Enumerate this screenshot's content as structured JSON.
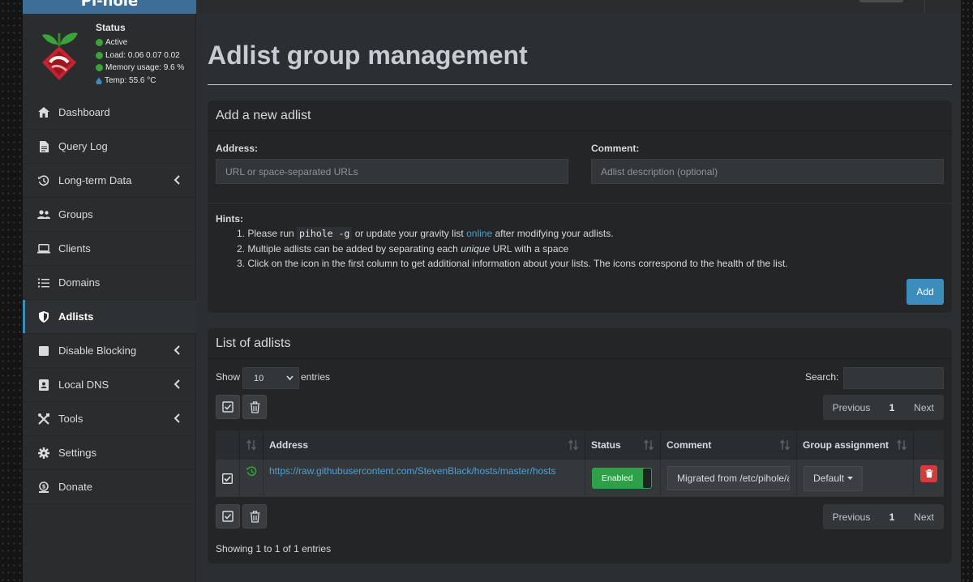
{
  "sidebar": {
    "brand": "Pi-hole",
    "status": {
      "title": "Status",
      "active": "Active",
      "load": "Load:  0.06  0.07  0.02",
      "memory": "Memory usage:  9.6 %",
      "temp": "Temp: 55.6 °C"
    },
    "items": [
      {
        "label": "Dashboard"
      },
      {
        "label": "Query Log"
      },
      {
        "label": "Long-term Data"
      },
      {
        "label": "Groups"
      },
      {
        "label": "Clients"
      },
      {
        "label": "Domains"
      },
      {
        "label": "Adlists"
      },
      {
        "label": "Disable Blocking"
      },
      {
        "label": "Local DNS"
      },
      {
        "label": "Tools"
      },
      {
        "label": "Settings"
      },
      {
        "label": "Donate"
      }
    ]
  },
  "page": {
    "title": "Adlist group management"
  },
  "add_box": {
    "header": "Add a new adlist",
    "address_label": "Address:",
    "address_placeholder": "URL or space-separated URLs",
    "comment_label": "Comment:",
    "comment_placeholder": "Adlist description (optional)",
    "hints_title": "Hints:",
    "hint1_pre": "1. Please run ",
    "hint1_code": "pihole -g",
    "hint1_mid": " or update your gravity list ",
    "hint1_link": "online",
    "hint1_post": " after modifying your adlists.",
    "hint2_pre": "2. Multiple adlists can be added by separating each ",
    "hint2_em": "unique",
    "hint2_post": " URL with a space",
    "hint3": "3. Click on the icon in the first column to get additional information about your lists. The icons correspond to the health of the list.",
    "add_button": "Add"
  },
  "list_box": {
    "header": "List of adlists",
    "show_label": "Show",
    "entries_value": "10",
    "entries_label": "entries",
    "search_label": "Search:",
    "search_value": "",
    "pager": {
      "previous": "Previous",
      "page": "1",
      "next": "Next"
    },
    "columns": [
      "",
      "",
      "Address",
      "Status",
      "Comment",
      "Group assignment",
      ""
    ],
    "rows": [
      {
        "address": "https://raw.githubusercontent.com/StevenBlack/hosts/master/hosts",
        "status": "Enabled",
        "comment": "Migrated from /etc/pihole/adlists.list",
        "group": "Default"
      }
    ],
    "footer": "Showing 1 to 1 of 1 entries"
  },
  "colors": {
    "accent": "#3c8dbc",
    "enabled": "#2ea04a",
    "danger": "#d33c3c",
    "link": "#4f9fd6"
  }
}
